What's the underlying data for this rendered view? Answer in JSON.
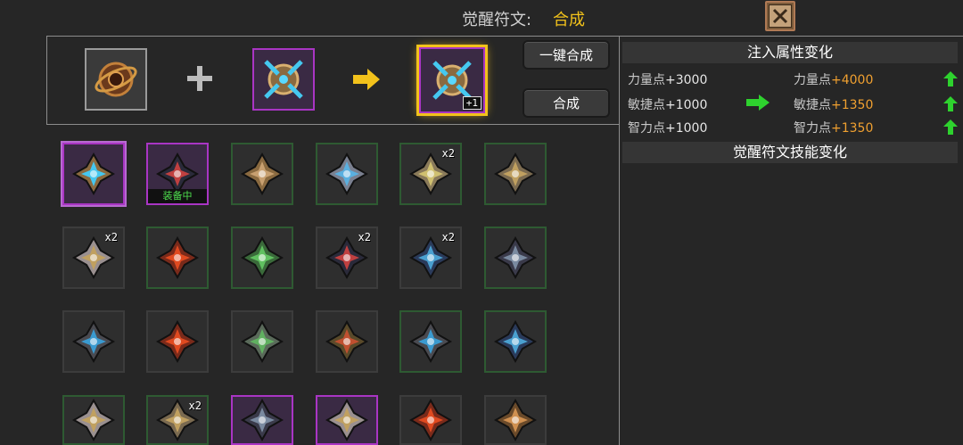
{
  "header": {
    "label": "觉醒符文:",
    "value": "合成"
  },
  "synthesis": {
    "plus_sign": "+",
    "result_level": "+1",
    "one_click_label": "一键合成",
    "synth_label": "合成"
  },
  "panel": {
    "attr_title": "注入属性变化",
    "skill_title": "觉醒符文技能变化",
    "attrs": [
      {
        "name": "力量点",
        "old": "+3000",
        "new": "+4000"
      },
      {
        "name": "敏捷点",
        "old": "+1000",
        "new": "+1350"
      },
      {
        "name": "智力点",
        "old": "+1000",
        "new": "+1350"
      }
    ]
  },
  "inventory": {
    "equipped_label": "装备中",
    "items": [
      {
        "icon": "compass-rune-blue-icon",
        "rarity": "purple",
        "selected": true,
        "badge": "",
        "equipped": false
      },
      {
        "icon": "wolf-head-rune-icon",
        "rarity": "purple",
        "badge": "",
        "equipped": true
      },
      {
        "icon": "compass-rune-bronze-icon",
        "rarity": "green",
        "badge": "",
        "equipped": false
      },
      {
        "icon": "crest-rune-blue-icon",
        "rarity": "green",
        "badge": "",
        "equipped": false
      },
      {
        "icon": "sword-wing-rune-icon",
        "rarity": "green",
        "badge": "x2",
        "equipped": false
      },
      {
        "icon": "cross-wing-rune-icon",
        "rarity": "green",
        "badge": "",
        "equipped": false
      },
      {
        "icon": "wing-shield-rune-icon",
        "rarity": "dark",
        "badge": "x2",
        "equipped": false
      },
      {
        "icon": "red-spike-rune-icon",
        "rarity": "green",
        "badge": "",
        "equipped": false
      },
      {
        "icon": "green-wing-rune-icon",
        "rarity": "green",
        "badge": "",
        "equipped": false
      },
      {
        "icon": "wolf-head-rune-icon",
        "rarity": "dark",
        "badge": "x2",
        "equipped": false
      },
      {
        "icon": "blue-blade-rune-icon",
        "rarity": "dark",
        "badge": "x2",
        "equipped": false
      },
      {
        "icon": "dark-shield-rune-icon",
        "rarity": "green",
        "badge": "",
        "equipped": false
      },
      {
        "icon": "blue-cross-rune-icon",
        "rarity": "dark",
        "badge": "",
        "equipped": false
      },
      {
        "icon": "red-spike-rune-icon",
        "rarity": "dark",
        "badge": "",
        "equipped": false
      },
      {
        "icon": "green-crest-rune-icon",
        "rarity": "dark",
        "badge": "",
        "equipped": false
      },
      {
        "icon": "horn-rune-icon",
        "rarity": "dark",
        "badge": "",
        "equipped": false
      },
      {
        "icon": "blue-cross-rune-icon",
        "rarity": "green",
        "badge": "",
        "equipped": false
      },
      {
        "icon": "blue-blade-rune-icon",
        "rarity": "green",
        "badge": "",
        "equipped": false
      },
      {
        "icon": "wing-shield-rune-icon",
        "rarity": "green",
        "badge": "",
        "equipped": false
      },
      {
        "icon": "cross-wing-rune-icon",
        "rarity": "green",
        "badge": "x2",
        "equipped": false
      },
      {
        "icon": "dark-shield-rune-icon",
        "rarity": "purple",
        "badge": "",
        "equipped": false
      },
      {
        "icon": "wing-shield-rune-icon",
        "rarity": "purple",
        "badge": "",
        "equipped": false
      },
      {
        "icon": "red-spike-rune-icon",
        "rarity": "dark",
        "badge": "",
        "equipped": false
      },
      {
        "icon": "bronze-cross-rune-icon",
        "rarity": "dark",
        "badge": "",
        "equipped": false
      }
    ]
  },
  "colors": {
    "accent": "#f2c21b",
    "new_value": "#f0a030",
    "up_arrow": "#2ed22e"
  }
}
